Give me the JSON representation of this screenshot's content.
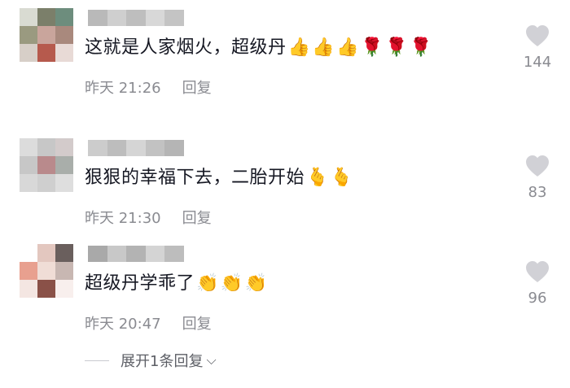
{
  "comments": [
    {
      "text": "这就是人家烟火，超级丹",
      "emojis": [
        "👍",
        "👍",
        "👍",
        "🌹",
        "🌹",
        "🌹"
      ],
      "time": "昨天 21:26",
      "reply_label": "回复",
      "likes": "144",
      "avatar_colors": [
        "#d9dbd2",
        "#7b7f6a",
        "#6d8d7d",
        "#9a9a80",
        "#c9a59c",
        "#a9897d",
        "#d7cfc8",
        "#b65a4d",
        "#e8dad6"
      ],
      "name_colors": [
        "#b9b9b9",
        "#cfcfcf",
        "#bebebe",
        "#d8d8d8",
        "#c4c4c4"
      ]
    },
    {
      "text": "狠狠的幸福下去，二胎开始",
      "emojis": [
        "🫰",
        "🫰"
      ],
      "time": "昨天 21:30",
      "reply_label": "回复",
      "likes": "83",
      "avatar_colors": [
        "#dcdcdc",
        "#c7c7c7",
        "#d3cbcb",
        "#c7c7c7",
        "#b98a8c",
        "#a9aeaa",
        "#d8d8d8",
        "#cfcfcf",
        "#dedede"
      ],
      "name_colors": [
        "#cccccc",
        "#bdbdbd",
        "#d5d5d5",
        "#c2c2c2",
        "#b5b5b5"
      ]
    },
    {
      "text": "超级丹学乖了",
      "emojis": [
        "👏",
        "👏",
        "👏"
      ],
      "time": "昨天 20:47",
      "reply_label": "回复",
      "likes": "96",
      "avatar_colors": [
        "#ffffff",
        "#e3c7bf",
        "#6a5f5d",
        "#e8a08f",
        "#f0ddd6",
        "#c8b7b2",
        "#f4e6e2",
        "#8a5148",
        "#f8efed"
      ],
      "name_colors": [
        "#a9a9a9",
        "#c8c8c8",
        "#b3b3b3",
        "#d4d4d4",
        "#bdbdbd"
      ]
    }
  ],
  "expand_label": "展开1条回复",
  "colors": {
    "text": "#161823",
    "meta": "#8a8b91",
    "heart": "#d1d1d6"
  }
}
